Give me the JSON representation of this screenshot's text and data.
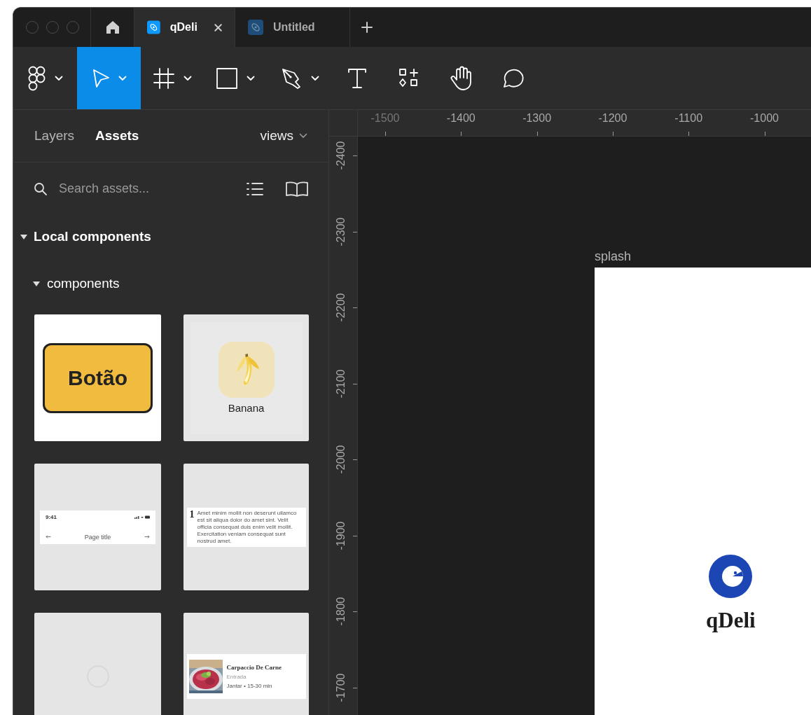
{
  "tabs": [
    {
      "kind": "home",
      "selected": false
    },
    {
      "kind": "file",
      "label": "qDeli",
      "selected": true
    },
    {
      "kind": "file",
      "label": "Untitled",
      "selected": false
    },
    {
      "kind": "new"
    }
  ],
  "toolbar": [
    {
      "kind": "logo",
      "selected": false,
      "menu": true
    },
    {
      "kind": "move",
      "selected": true,
      "menu": true
    },
    {
      "kind": "frame",
      "selected": false,
      "menu": true
    },
    {
      "kind": "shape",
      "selected": false,
      "menu": true
    },
    {
      "kind": "pen",
      "selected": false,
      "menu": true
    },
    {
      "kind": "text",
      "selected": false,
      "menu": false
    },
    {
      "kind": "resources",
      "selected": false,
      "menu": false
    },
    {
      "kind": "hand",
      "selected": false,
      "menu": false
    },
    {
      "kind": "comment",
      "selected": false,
      "menu": false
    }
  ],
  "panel": {
    "tabs": [
      {
        "label": "Layers",
        "selected": false
      },
      {
        "label": "Assets",
        "selected": true
      }
    ],
    "library": "views",
    "search": {
      "placeholder": "Search assets..."
    },
    "sections": [
      {
        "label": "Local components",
        "expanded": true,
        "children": [
          {
            "label": "components",
            "expanded": true,
            "components": [
              {
                "kind": "button",
                "label": "Botão"
              },
              {
                "kind": "icon",
                "label": "Banana"
              },
              {
                "kind": "navbar",
                "time": "9:41",
                "title": "Page title"
              },
              {
                "kind": "paragraph",
                "number": "1",
                "text": "Amet minim mollit non deserunt ullamco est sit aliqua dolor do amet sint. Velit officia consequat duis enim velit mollit. Exercitation veniam consequat sunt nostrud amet."
              },
              {
                "kind": "loader"
              },
              {
                "kind": "food",
                "title": "Carpaccio De Carne",
                "category": "Entrada",
                "meta": "Jantar • 15-30 min"
              }
            ]
          }
        ]
      }
    ]
  },
  "rulers": {
    "horizontal": [
      "-1500",
      "-1400",
      "-1300",
      "-1200",
      "-1100",
      "-1000"
    ],
    "vertical": [
      "-2400",
      "-2300",
      "-2200",
      "-2100",
      "-2000",
      "-1900",
      "-1800",
      "-1700"
    ]
  },
  "canvas": {
    "frames": [
      {
        "name": "splash",
        "logo_text": "qDeli"
      }
    ]
  }
}
